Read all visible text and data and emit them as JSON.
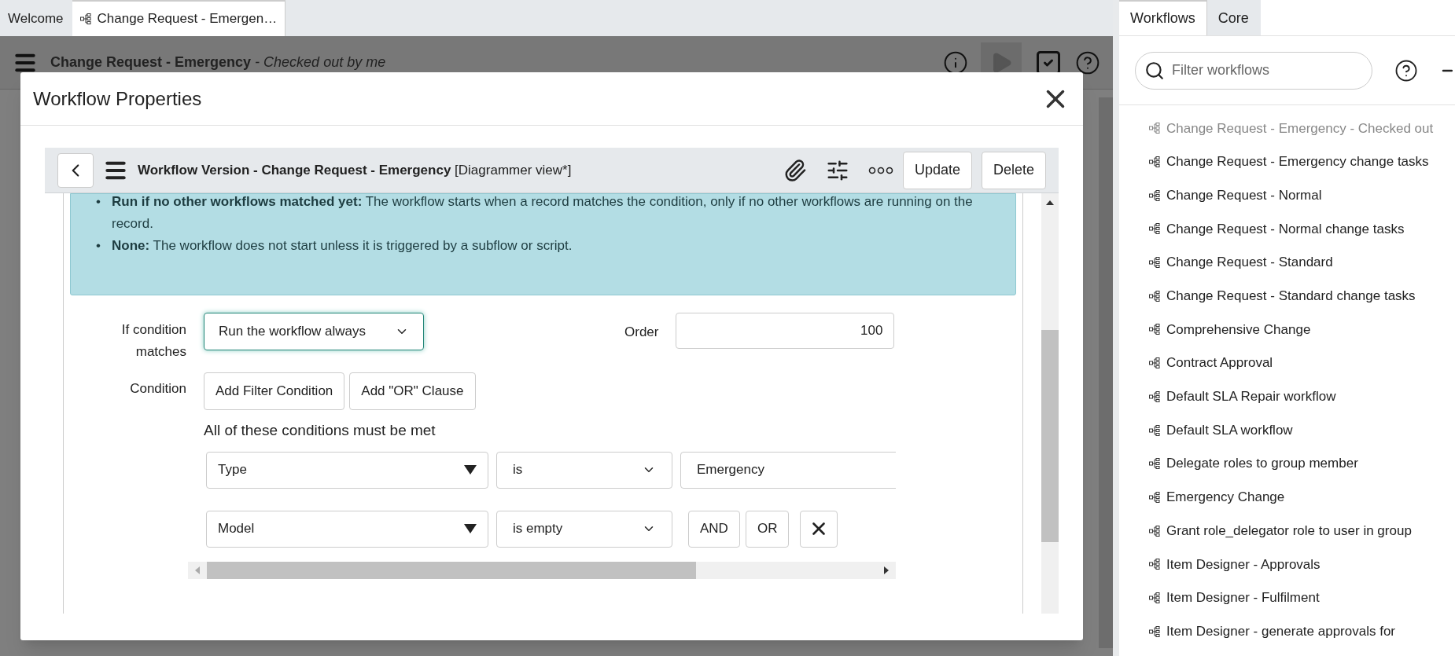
{
  "tabs": [
    {
      "label": "Welcome",
      "selected": false,
      "kind": "plain"
    },
    {
      "label": "Change Request - Emergen…",
      "selected": true,
      "kind": "workflow"
    }
  ],
  "header": {
    "title": "Change Request - Emergency",
    "subtitle": "- Checked out by me"
  },
  "dialog": {
    "title": "Workflow Properties",
    "toolbar": {
      "title": "Workflow Version - Change Request - Emergency",
      "view": "[Diagrammer view*]",
      "buttons": [
        "Update",
        "Delete"
      ]
    },
    "info_items": [
      {
        "bullet": "•",
        "text": "**Run if no other workflows matched yet:** The workflow starts when a record matches the condition, only if no other workflows are running on the record."
      },
      {
        "bullet": "•",
        "text": "**None:** The workflow does not start unless it is triggered by a subflow or script."
      }
    ],
    "if_condition": {
      "label": "If condition matches",
      "value": "Run the workflow always"
    },
    "order": {
      "label": "Order",
      "value": "100"
    },
    "condition": {
      "label": "Condition",
      "buttons": [
        "Add Filter Condition",
        "Add \"OR\" Clause"
      ],
      "note": "All of these conditions must be met",
      "rows": [
        {
          "field": "Type",
          "operator": "is",
          "value": "Emergency"
        },
        {
          "field": "Model",
          "operator": "is empty",
          "buttons": [
            "AND",
            "OR"
          ]
        }
      ]
    }
  },
  "side_panel": {
    "tabs": [
      {
        "label": "Workflows",
        "selected": true
      },
      {
        "label": "Core",
        "selected": false
      }
    ],
    "search": {
      "placeholder": "Filter workflows"
    },
    "items": [
      {
        "label": "Change Request - Emergency - Checked out",
        "disabled": true
      },
      {
        "label": "Change Request - Emergency change tasks",
        "disabled": false
      },
      {
        "label": "Change Request - Normal",
        "disabled": false
      },
      {
        "label": "Change Request - Normal change tasks",
        "disabled": false
      },
      {
        "label": "Change Request - Standard",
        "disabled": false
      },
      {
        "label": "Change Request - Standard change tasks",
        "disabled": false
      },
      {
        "label": "Comprehensive Change",
        "disabled": false
      },
      {
        "label": "Contract Approval",
        "disabled": false
      },
      {
        "label": "Default SLA Repair workflow",
        "disabled": false
      },
      {
        "label": "Default SLA workflow",
        "disabled": false
      },
      {
        "label": "Delegate roles to group member",
        "disabled": false
      },
      {
        "label": "Emergency Change",
        "disabled": false
      },
      {
        "label": "Grant role_delegator role to user in group",
        "disabled": false
      },
      {
        "label": "Item Designer - Approvals",
        "disabled": false
      },
      {
        "label": "Item Designer - Fulfilment",
        "disabled": false
      },
      {
        "label": "Item Designer - generate approvals for",
        "disabled": false
      }
    ]
  }
}
